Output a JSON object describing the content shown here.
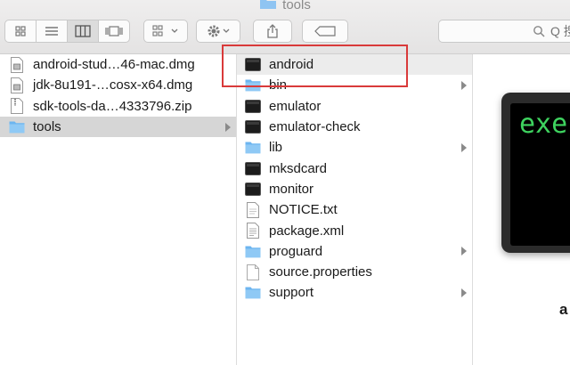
{
  "window": {
    "title": "tools"
  },
  "search": {
    "placeholder": "Q 搜"
  },
  "toolbar": {
    "view_icons": [
      "icon-view-icon",
      "list-view-icon",
      "column-view-icon",
      "coverflow-view-icon"
    ]
  },
  "column1": {
    "items": [
      {
        "name": "android-stud…46-mac.dmg",
        "type": "dmg"
      },
      {
        "name": "jdk-8u191-…cosx-x64.dmg",
        "type": "dmg"
      },
      {
        "name": "sdk-tools-da…4333796.zip",
        "type": "zip"
      },
      {
        "name": "tools",
        "type": "folder",
        "selected": true
      }
    ]
  },
  "column2": {
    "items": [
      {
        "name": "android",
        "type": "exec",
        "highlighted": true
      },
      {
        "name": "bin",
        "type": "folder"
      },
      {
        "name": "emulator",
        "type": "exec"
      },
      {
        "name": "emulator-check",
        "type": "exec"
      },
      {
        "name": "lib",
        "type": "folder"
      },
      {
        "name": "mksdcard",
        "type": "exec"
      },
      {
        "name": "monitor",
        "type": "exec"
      },
      {
        "name": "NOTICE.txt",
        "type": "txt"
      },
      {
        "name": "package.xml",
        "type": "xml"
      },
      {
        "name": "proguard",
        "type": "folder"
      },
      {
        "name": "source.properties",
        "type": "doc"
      },
      {
        "name": "support",
        "type": "folder"
      }
    ]
  },
  "preview": {
    "icon_text": "exe",
    "name": "a"
  },
  "colors": {
    "folder": "#6cb5f0",
    "red_box": "#d93a3a",
    "terminal_green": "#3ed35f"
  }
}
